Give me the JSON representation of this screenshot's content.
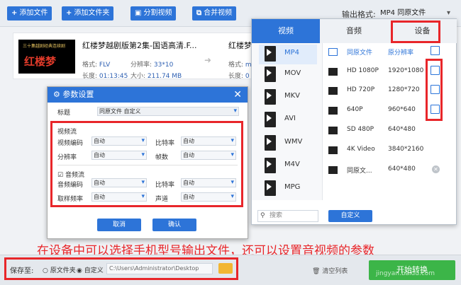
{
  "toolbar": {
    "add_file": "添加文件",
    "add_folder": "添加文件夹",
    "split_video": "分割视频",
    "merge_video": "合并视频",
    "output_format_label": "输出格式:",
    "output_format_value": "MP4 同原文件"
  },
  "file_item": {
    "thumb_line1": "三十集越剧经典连续剧",
    "thumb_line2": "红楼梦",
    "name": "红楼梦越剧版第2集-国语高清.F...",
    "format_label": "格式:",
    "format_value": "FLV",
    "resolution_label": "分辨率:",
    "resolution_value": "33*10",
    "duration_label": "长度:",
    "duration_value": "01:13:45",
    "size_label": "大小:",
    "size_value": "211.74 MB",
    "name2": "红楼梦",
    "format2_label": "格式:",
    "format2_value": "m",
    "duration2_label": "长度:",
    "duration2_value": "0"
  },
  "dialog": {
    "title": "参数设置",
    "caption_label": "标题",
    "caption_value": "同原文件 自定义",
    "video_stream": "视频流",
    "video_codec_label": "视频编码",
    "video_codec_value": "自动",
    "bitrate_label": "比特率",
    "bitrate_value": "自动",
    "resolution_label": "分辨率",
    "resolution_value": "自动",
    "framerate_label": "帧数",
    "framerate_value": "自动",
    "audio_stream": "音频流",
    "audio_codec_label": "音频编码",
    "audio_codec_value": "自动",
    "audio_bitrate_label": "比特率",
    "audio_bitrate_value": "自动",
    "samplerate_label": "取样频率",
    "samplerate_value": "自动",
    "channel_label": "声道",
    "channel_value": "自动",
    "cancel": "取消",
    "ok": "确认"
  },
  "panel": {
    "tabs": [
      "视频",
      "音频",
      "设备"
    ],
    "formats": [
      "MP4",
      "MOV",
      "MKV",
      "AVI",
      "WMV",
      "M4V",
      "MPG"
    ],
    "qualities": [
      {
        "name": "同原文件",
        "res": "原分辨率"
      },
      {
        "name": "HD 1080P",
        "res": "1920*1080"
      },
      {
        "name": "HD 720P",
        "res": "1280*720"
      },
      {
        "name": "640P",
        "res": "960*640"
      },
      {
        "name": "SD 480P",
        "res": "640*480"
      },
      {
        "name": "4K Video",
        "res": "3840*2160"
      },
      {
        "name": "同原文...",
        "res": "640*480"
      }
    ],
    "search_placeholder": "搜索",
    "custom_button": "自定义"
  },
  "bottom": {
    "save_to": "保存至:",
    "opt_original": "原文件夹",
    "opt_custom": "自定义",
    "path": "C:\\Users\\Administrator\\Desktop",
    "clear_list": "清空列表",
    "start_convert": "开始转换"
  },
  "caption": "在设备中可以选择手机型号输出文件，还可以设置音视频的参数",
  "watermark": "jingyan.baidu.com",
  "colors": {
    "accent": "#2d74d8",
    "annotation": "#e8262a",
    "convert": "#3cb548"
  }
}
